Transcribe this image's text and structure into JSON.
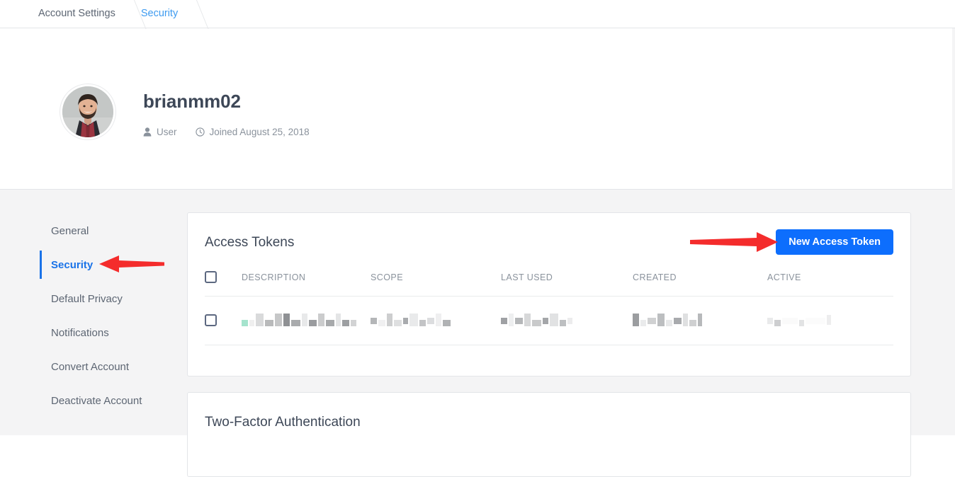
{
  "breadcrumb": {
    "items": [
      {
        "label": "Account Settings",
        "active": false
      },
      {
        "label": "Security",
        "active": true
      }
    ]
  },
  "profile": {
    "username": "brianmm02",
    "role": "User",
    "joined": "Joined August 25, 2018",
    "avatar_alt": "user-avatar"
  },
  "sidebar": {
    "items": [
      {
        "label": "General"
      },
      {
        "label": "Security"
      },
      {
        "label": "Default Privacy"
      },
      {
        "label": "Notifications"
      },
      {
        "label": "Convert Account"
      },
      {
        "label": "Deactivate Account"
      }
    ],
    "active_index": 1
  },
  "tokens_card": {
    "title": "Access Tokens",
    "new_token_button": "New Access Token",
    "columns": [
      "DESCRIPTION",
      "SCOPE",
      "LAST USED",
      "CREATED",
      "ACTIVE"
    ],
    "rows": [
      {
        "description": "",
        "scope": "",
        "last_used": "",
        "created": "",
        "active": "",
        "redacted": true
      }
    ]
  },
  "twofactor_card": {
    "title": "Two-Factor Authentication"
  },
  "annotations": [
    {
      "name": "arrow-to-security",
      "color": "#f42c2c",
      "direction": "left"
    },
    {
      "name": "arrow-to-new-access-token",
      "color": "#f42c2c",
      "direction": "right"
    }
  ],
  "colors": {
    "accent_blue": "#1a73e8",
    "button_blue": "#0d6efd",
    "link_blue": "#3e9bf0",
    "page_bg": "#f4f4f5",
    "text": "#3d4757",
    "muted_text": "#8a929c",
    "annotation_red": "#f42c2c",
    "token_status_green": "#a5e3cd"
  }
}
